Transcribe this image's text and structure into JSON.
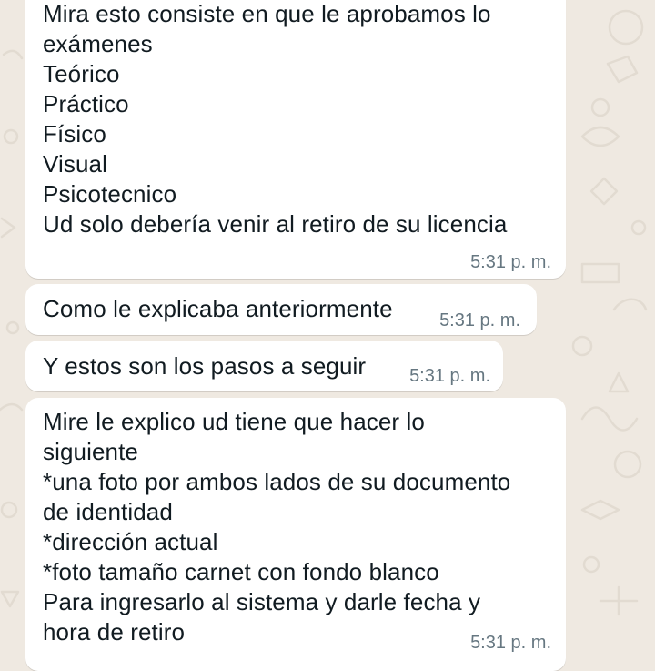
{
  "chat": {
    "messages": [
      {
        "text": "Mira esto consiste en que le aprobamos lo\nexámenes\nTeórico\nPráctico\nFísico\nVisual\nPsicotecnico\nUd solo debería venir al retiro de su licencia",
        "time": "5:31 p. m."
      },
      {
        "text": "Como le explicaba anteriormente",
        "time": "5:31 p. m."
      },
      {
        "text": "Y estos son los pasos a seguir",
        "time": "5:31 p. m."
      },
      {
        "text": "Mire le explico ud tiene que hacer lo\nsiguiente\n*una foto por ambos lados de su documento\nde identidad\n*dirección actual\n*foto tamaño carnet con fondo blanco\nPara ingresarlo al sistema y darle fecha y\nhora de retiro",
        "time": "5:31 p. m."
      }
    ]
  },
  "theme": {
    "wallpaper_color": "#efe9e1",
    "bubble_color": "#ffffff",
    "text_color": "#111b21",
    "time_color": "#667781"
  }
}
